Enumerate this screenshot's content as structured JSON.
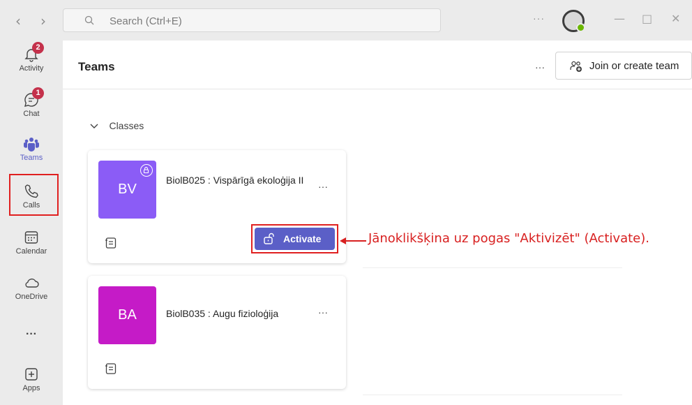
{
  "titlebar": {
    "search_placeholder": "Search (Ctrl+E)",
    "more": "···"
  },
  "rail": {
    "items": [
      {
        "label": "Activity",
        "badge": "2",
        "icon": "bell-icon"
      },
      {
        "label": "Chat",
        "badge": "1",
        "icon": "chat-icon"
      },
      {
        "label": "Teams",
        "icon": "teams-icon",
        "selected": true
      },
      {
        "label": "Calls",
        "icon": "phone-icon"
      },
      {
        "label": "Calendar",
        "icon": "calendar-icon"
      },
      {
        "label": "OneDrive",
        "icon": "cloud-icon"
      },
      {
        "label": "···",
        "icon": "more-icon"
      },
      {
        "label": "Apps",
        "icon": "apps-plus-icon"
      }
    ]
  },
  "header": {
    "title": "Teams",
    "more": "···",
    "join_label": "Join or create team"
  },
  "main": {
    "section_label": "Classes",
    "teams": [
      {
        "initials": "BV",
        "name": "BiolB025 : Vispārīgā ekoloģija II",
        "tile_color": "#8b5cf6",
        "more": "···",
        "action_label": "Activate"
      },
      {
        "initials": "BA",
        "name": "BiolB035 : Augu fizioloģija",
        "tile_color": "#c51bc7",
        "more": "···"
      }
    ]
  },
  "annotation": {
    "text": "Jānoklikšķina uz pogas \"Aktivizēt\" (Activate)."
  },
  "colors": {
    "accent": "#5b5fc7",
    "highlight": "#e02020",
    "badge": "#c4314b"
  }
}
